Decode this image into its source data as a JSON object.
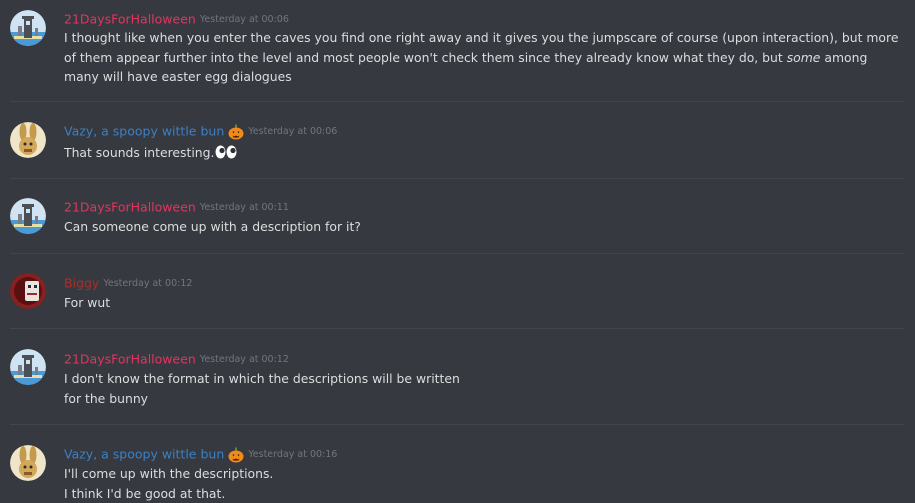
{
  "messages": [
    {
      "author": "21DaysForHalloween",
      "author_color": "#e0355f",
      "timestamp": "Yesterday at 00:06",
      "text_before": "I thought like when you enter the caves you find one right away and it gives you the jumpscare of course (upon interaction), but more of them appear further into the level and most people won't check them since they already know what they do, but ",
      "text_em": "some",
      "text_after": " among many will have easter egg dialogues"
    },
    {
      "author": "Vazy, a spoopy wittle bun",
      "author_color": "#3b80c4",
      "timestamp": "Yesterday at 00:06",
      "text": "That sounds interesting.",
      "emoji": "eyes"
    },
    {
      "author": "21DaysForHalloween",
      "author_color": "#e0355f",
      "timestamp": "Yesterday at 00:11",
      "text": "Can someone come up with a description for it?"
    },
    {
      "author": "Biggy",
      "author_color": "#a8302a",
      "timestamp": "Yesterday at 00:12",
      "text": "For wut"
    },
    {
      "author": "21DaysForHalloween",
      "author_color": "#e0355f",
      "timestamp": "Yesterday at 00:12",
      "line1": "I don't know the format in which the descriptions will be written",
      "line2": "for the bunny"
    },
    {
      "author": "Vazy, a spoopy wittle bun",
      "author_color": "#3b80c4",
      "timestamp": "Yesterday at 00:16",
      "line1": "I'll come up with the descriptions.",
      "line2": "I think I'd be good at that."
    }
  ],
  "icons": {
    "avatar_21days": "tower-avatar-icon",
    "avatar_vazy": "bunny-avatar-icon",
    "avatar_biggy": "creature-avatar-icon",
    "role_badge": "pumpkin-icon",
    "emoji": "eyes-icon"
  },
  "colors": {
    "background": "#36393f",
    "text": "#dcddde",
    "timestamp": "#72767d",
    "divider": "#42454a"
  }
}
